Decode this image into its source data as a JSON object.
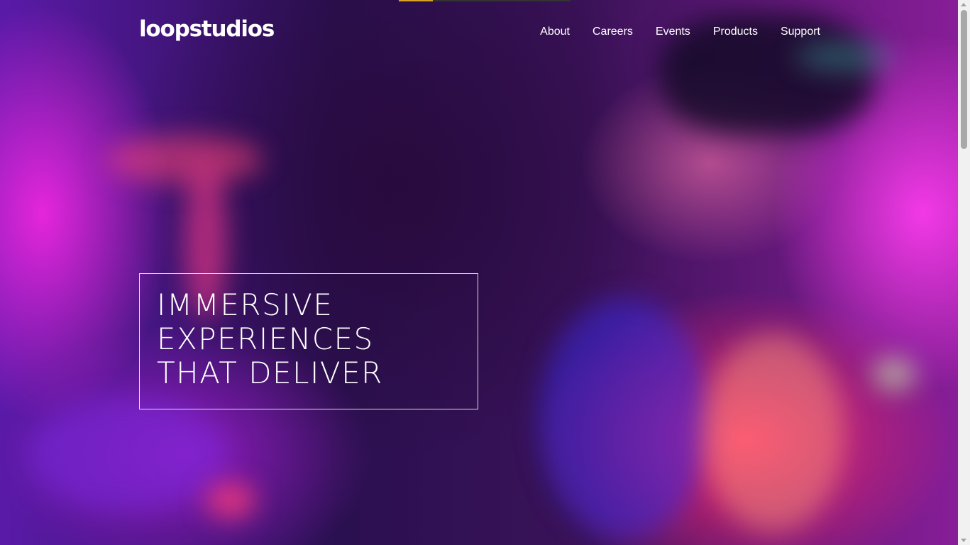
{
  "brand": {
    "name": "loopstudios"
  },
  "nav": {
    "items": [
      {
        "label": "About"
      },
      {
        "label": "Careers"
      },
      {
        "label": "Events"
      },
      {
        "label": "Products"
      },
      {
        "label": "Support"
      }
    ]
  },
  "hero": {
    "headline_lines": [
      "IMMERSIVE",
      "EXPERIENCES",
      "THAT DELIVER"
    ]
  },
  "colors": {
    "text": "#ffffff",
    "accent_bar": "#d7a12a",
    "hero_magenta": "#ff28e6",
    "hero_red": "#ff286e",
    "hero_blue": "#3c28dc"
  }
}
